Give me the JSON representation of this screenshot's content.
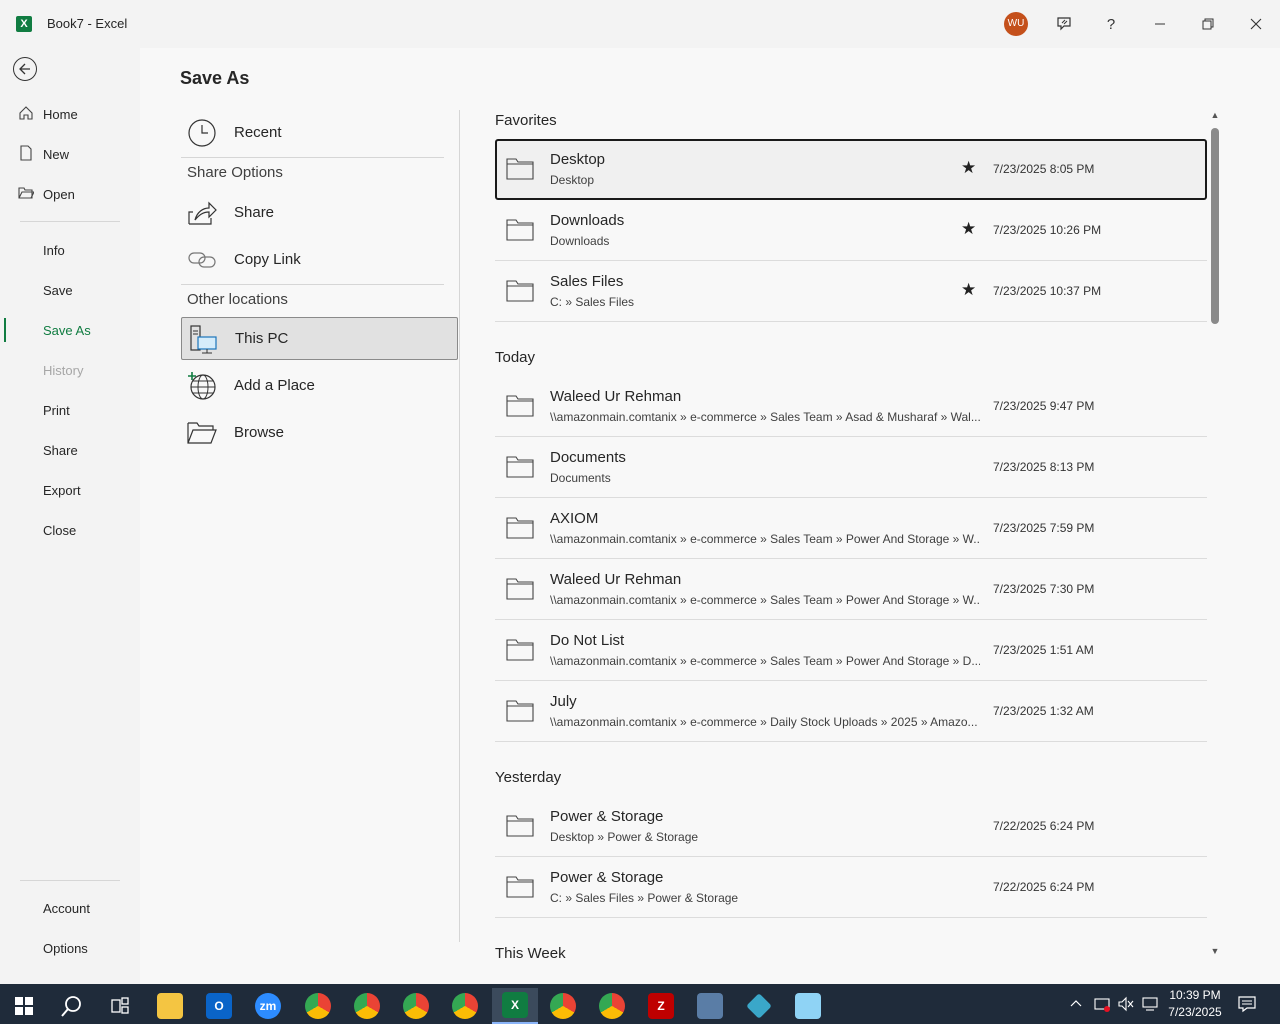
{
  "window": {
    "app_icon_letter": "X",
    "title": "Book7  -  Excel",
    "avatar_initials": "WU",
    "buttons": [
      "feedback-icon",
      "help",
      "minimize",
      "restore",
      "close"
    ],
    "help_glyph": "?"
  },
  "nav": {
    "top_items": [
      {
        "label": "Home",
        "icon": "home-icon"
      },
      {
        "label": "New",
        "icon": "new-document-icon"
      },
      {
        "label": "Open",
        "icon": "open-folder-icon"
      }
    ],
    "mid_items": [
      {
        "label": "Info"
      },
      {
        "label": "Save"
      },
      {
        "label": "Save As",
        "active": true
      },
      {
        "label": "History",
        "disabled": true
      },
      {
        "label": "Print"
      },
      {
        "label": "Share"
      },
      {
        "label": "Export"
      },
      {
        "label": "Close"
      }
    ],
    "bottom_items": [
      {
        "label": "Account"
      },
      {
        "label": "Options"
      }
    ]
  },
  "page_title": "Save As",
  "locations": {
    "recent": "Recent",
    "share_header": "Share Options",
    "share": "Share",
    "copy_link": "Copy Link",
    "other_header": "Other locations",
    "this_pc": "This PC",
    "add_place": "Add a Place",
    "browse": "Browse"
  },
  "groups": {
    "favorites": "Favorites",
    "today": "Today",
    "yesterday": "Yesterday",
    "this_week": "This Week"
  },
  "favorites": [
    {
      "name": "Desktop",
      "path": "Desktop",
      "date": "7/23/2025 8:05 PM",
      "pinned": true
    },
    {
      "name": "Downloads",
      "path": "Downloads",
      "date": "7/23/2025 10:26 PM",
      "pinned": true
    },
    {
      "name": "Sales Files",
      "path": "C: » Sales Files",
      "date": "7/23/2025 10:37 PM",
      "pinned": true
    }
  ],
  "today": [
    {
      "name": "Waleed Ur Rehman",
      "path": "\\\\amazonmain.comtanix » e-commerce » Sales Team » Asad & Musharaf » Wal...",
      "date": "7/23/2025 9:47 PM"
    },
    {
      "name": "Documents",
      "path": "Documents",
      "date": "7/23/2025 8:13 PM"
    },
    {
      "name": "AXIOM",
      "path": "\\\\amazonmain.comtanix » e-commerce » Sales Team » Power And Storage » W...",
      "date": "7/23/2025 7:59 PM"
    },
    {
      "name": "Waleed Ur Rehman",
      "path": "\\\\amazonmain.comtanix » e-commerce » Sales Team » Power And Storage » W...",
      "date": "7/23/2025 7:30 PM"
    },
    {
      "name": "Do Not List",
      "path": "\\\\amazonmain.comtanix » e-commerce » Sales Team » Power And Storage » D...",
      "date": "7/23/2025 1:51 AM"
    },
    {
      "name": "July",
      "path": "\\\\amazonmain.comtanix » e-commerce » Daily Stock Uploads » 2025 » Amazo...",
      "date": "7/23/2025 1:32 AM"
    }
  ],
  "yesterday": [
    {
      "name": "Power & Storage",
      "path": "Desktop » Power & Storage",
      "date": "7/22/2025 6:24 PM"
    },
    {
      "name": "Power & Storage",
      "path": "C: » Sales Files » Power & Storage",
      "date": "7/22/2025 6:24 PM"
    }
  ],
  "taskbar": {
    "apps": [
      "windows-start-icon",
      "search-icon",
      "task-view-icon",
      "file-explorer-icon",
      "outlook-icon",
      "zoom-icon",
      "chrome-icon",
      "chrome-icon",
      "chrome-icon",
      "chrome-icon",
      "excel-icon",
      "chrome-icon",
      "chrome-icon",
      "filezilla-icon",
      "calculator-icon",
      "app-icon",
      "notepad-icon"
    ],
    "zoom_label": "zm",
    "clock_time": "10:39 PM",
    "clock_date": "7/23/2025"
  },
  "colors": {
    "accent": "#107c41",
    "avatar": "#c4501b",
    "taskbar": "#1f2b3a"
  }
}
